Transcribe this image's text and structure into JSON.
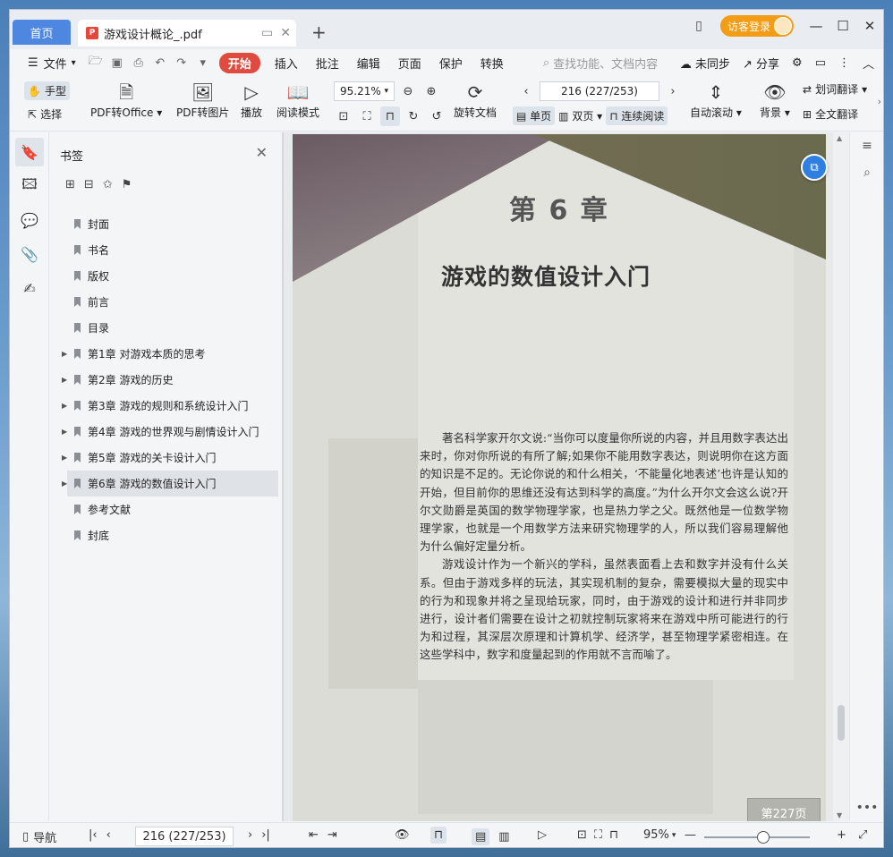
{
  "tabs": {
    "home": "首页",
    "document": "游戏设计概论_.pdf"
  },
  "titlebar": {
    "login": "访客登录"
  },
  "menu": {
    "file": "文件",
    "items": [
      "开始",
      "插入",
      "批注",
      "编辑",
      "页面",
      "保护",
      "转换"
    ],
    "search_placeholder": "查找功能、文档内容",
    "sync": "未同步",
    "share": "分享"
  },
  "toolbar": {
    "hand": "手型",
    "select": "选择",
    "pdf_to_office": "PDF转Office",
    "pdf_to_image": "PDF转图片",
    "play": "播放",
    "read_mode": "阅读模式",
    "zoom": "95.21%",
    "rotate": "旋转文档",
    "page": "216 (227/253)",
    "single": "单页",
    "double": "双页",
    "continuous": "连续阅读",
    "auto_scroll": "自动滚动",
    "background": "背景",
    "word_translate": "划词翻译",
    "full_translate": "全文翻译"
  },
  "bookmarks": {
    "title": "书签",
    "items": [
      {
        "label": "封面",
        "expandable": false
      },
      {
        "label": "书名",
        "expandable": false
      },
      {
        "label": "版权",
        "expandable": false
      },
      {
        "label": "前言",
        "expandable": false
      },
      {
        "label": "目录",
        "expandable": false
      },
      {
        "label": "第1章 对游戏本质的思考",
        "expandable": true
      },
      {
        "label": "第2章 游戏的历史",
        "expandable": true
      },
      {
        "label": "第3章 游戏的规则和系统设计入门",
        "expandable": true
      },
      {
        "label": "第4章 游戏的世界观与剧情设计入门",
        "expandable": true
      },
      {
        "label": "第5章 游戏的关卡设计入门",
        "expandable": true
      },
      {
        "label": "第6章 游戏的数值设计入门",
        "expandable": true,
        "selected": true
      },
      {
        "label": "参考文献",
        "expandable": false
      },
      {
        "label": "封底",
        "expandable": false
      }
    ]
  },
  "document_page": {
    "chapter_number": "第 6 章",
    "chapter_title": "游戏的数值设计入门",
    "paragraph_1": "著名科学家开尔文说:“当你可以度量你所说的内容，并且用数字表达出来时，你对你所说的有所了解;如果你不能用数字表达，则说明你在这方面的知识是不足的。无论你说的和什么相关，‘不能量化地表述’也许是认知的开始，但目前你的思维还没有达到科学的高度。”为什么开尔文会这么说?开尔文勋爵是英国的数学物理学家，也是热力学之父。既然他是一位数学物理学家，也就是一个用数学方法来研究物理学的人，所以我们容易理解他为什么偏好定量分析。",
    "paragraph_2": "游戏设计作为一个新兴的学科，虽然表面看上去和数字并没有什么关系。但由于游戏多样的玩法，其实现机制的复杂，需要模拟大量的现实中的行为和现象并将之呈现给玩家，同时，由于游戏的设计和进行并非同步进行，设计者们需要在设计之初就控制玩家将来在游戏中所可能进行的行为和过程，其深层次原理和计算机学、经济学，甚至物理学紧密相连。在这些学科中，数字和度量起到的作用就不言而喻了。",
    "page_badge": "第227页"
  },
  "statusbar": {
    "nav": "导航",
    "page": "216 (227/253)",
    "zoom": "95%"
  }
}
